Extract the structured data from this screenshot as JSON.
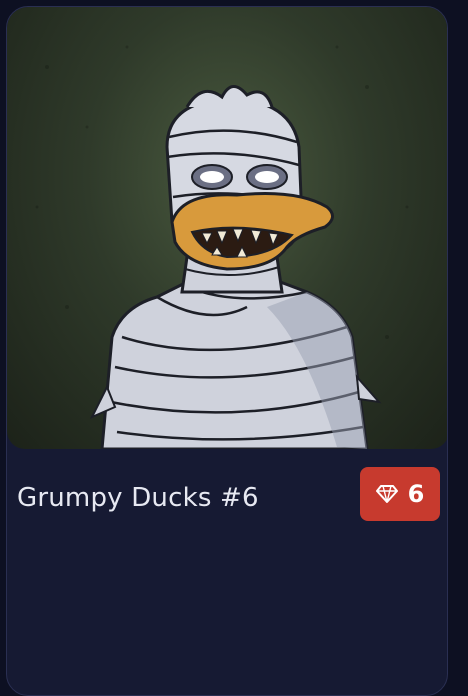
{
  "card": {
    "title": "Grumpy Ducks #6",
    "artwork_alt": "Mummy duck illustration",
    "badge": {
      "icon": "gem-icon",
      "value": "6",
      "color": "#c73a2e"
    }
  }
}
